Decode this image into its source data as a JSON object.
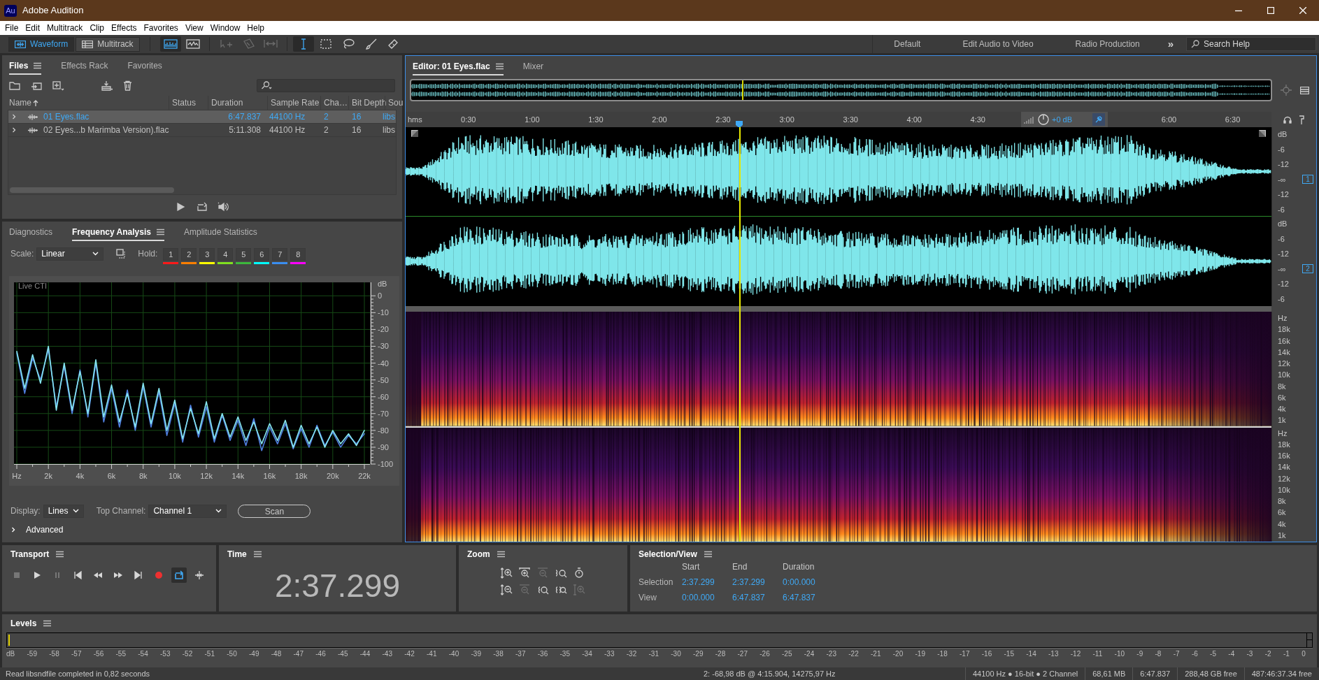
{
  "window": {
    "title": "Adobe Audition",
    "app_badge": "Au"
  },
  "menu": [
    "File",
    "Edit",
    "Multitrack",
    "Clip",
    "Effects",
    "Favorites",
    "View",
    "Window",
    "Help"
  ],
  "view_modes": [
    {
      "label": "Waveform",
      "kind": "waveform",
      "selected": true
    },
    {
      "label": "Multitrack",
      "kind": "multitrack",
      "selected": false
    }
  ],
  "tools": [
    {
      "kind": "spectral",
      "selected": true,
      "disabled": false
    },
    {
      "kind": "pitch",
      "selected": false,
      "disabled": false
    },
    {
      "kind": "move",
      "selected": false,
      "disabled": true
    },
    {
      "kind": "razor",
      "selected": false,
      "disabled": true
    },
    {
      "kind": "slip",
      "selected": false,
      "disabled": true
    },
    {
      "kind": "time",
      "selected": true,
      "disabled": false
    },
    {
      "kind": "marquee",
      "selected": false,
      "disabled": false
    },
    {
      "kind": "lasso",
      "selected": false,
      "disabled": false
    },
    {
      "kind": "brush",
      "selected": false,
      "disabled": false
    },
    {
      "kind": "heal",
      "selected": false,
      "disabled": false
    }
  ],
  "workspaces": [
    "Default",
    "Edit Audio to Video",
    "Radio Production"
  ],
  "workspace_more": "»",
  "help_search": {
    "placeholder": "Search Help"
  },
  "files": {
    "tabs": [
      {
        "label": "Files",
        "selected": true
      },
      {
        "label": "Effects Rack",
        "selected": false
      },
      {
        "label": "Favorites",
        "selected": false
      }
    ],
    "columns": [
      {
        "label": "Name",
        "sorted": true
      },
      {
        "label": "Status",
        "sorted": false
      },
      {
        "label": "Duration",
        "sorted": false
      },
      {
        "label": "Sample Rate",
        "sorted": false
      },
      {
        "label": "Cha…",
        "sorted": false
      },
      {
        "label": "Bit Depth",
        "sorted": false
      },
      {
        "label": "Sou",
        "sorted": false
      }
    ],
    "rows": [
      {
        "name": "01 Eyes.flac",
        "duration": "6:47.837",
        "sample_rate": "44100 Hz",
        "channels": "2",
        "bit_depth": "16",
        "source": "libs",
        "selected": true,
        "expanded": false
      },
      {
        "name": "02 Eyes...b Marimba Version).flac",
        "duration": "5:11.308",
        "sample_rate": "44100 Hz",
        "channels": "2",
        "bit_depth": "16",
        "source": "libs",
        "selected": false,
        "expanded": false
      }
    ]
  },
  "analysis": {
    "tabs": [
      {
        "label": "Diagnostics",
        "selected": false
      },
      {
        "label": "Frequency Analysis",
        "selected": true
      },
      {
        "label": "Amplitude Statistics",
        "selected": false
      }
    ],
    "scale": {
      "label": "Scale:",
      "value": "Linear"
    },
    "hold_label": "Hold:",
    "hold": [
      {
        "label": "1",
        "color": "#ff1a1a"
      },
      {
        "label": "2",
        "color": "#ff7f00"
      },
      {
        "label": "3",
        "color": "#ffff00"
      },
      {
        "label": "4",
        "color": "#80e020"
      },
      {
        "label": "5",
        "color": "#3cb83c"
      },
      {
        "label": "6",
        "color": "#00ffff"
      },
      {
        "label": "7",
        "color": "#3a8ef0"
      },
      {
        "label": "8",
        "color": "#ff00ff"
      }
    ],
    "live_label": "Live CTI",
    "chart_data": {
      "type": "line",
      "ylabel": "dB",
      "x": [
        0,
        500,
        1000,
        1500,
        2000,
        2500,
        3000,
        3500,
        4000,
        4500,
        5000,
        5500,
        6000,
        6500,
        7000,
        7500,
        8000,
        8500,
        9000,
        9500,
        10000,
        10500,
        11000,
        11500,
        12000,
        12500,
        13000,
        13500,
        14000,
        14500,
        15000,
        15500,
        16000,
        16500,
        17000,
        17500,
        18000,
        18500,
        19000,
        19500,
        20000,
        20500,
        21000,
        21500,
        22000
      ],
      "series": [
        {
          "color": "#4f7fe0",
          "values": [
            -34,
            -58,
            -37,
            -50,
            -32,
            -66,
            -42,
            -70,
            -44,
            -72,
            -40,
            -75,
            -55,
            -78,
            -56,
            -80,
            -54,
            -78,
            -57,
            -83,
            -64,
            -87,
            -65,
            -84,
            -66,
            -87,
            -71,
            -86,
            -74,
            -89,
            -73,
            -92,
            -78,
            -88,
            -76,
            -91,
            -79,
            -90,
            -77,
            -89,
            -81,
            -90,
            -83,
            -88,
            -82
          ]
        },
        {
          "color": "#86e6f0",
          "values": [
            -33,
            -55,
            -35,
            -52,
            -30,
            -68,
            -40,
            -68,
            -45,
            -70,
            -38,
            -72,
            -53,
            -75,
            -58,
            -78,
            -52,
            -76,
            -55,
            -80,
            -62,
            -85,
            -67,
            -82,
            -63,
            -85,
            -70,
            -84,
            -72,
            -86,
            -75,
            -88,
            -76,
            -86,
            -74,
            -90,
            -77,
            -88,
            -78,
            -90,
            -80,
            -88,
            -82,
            -89,
            -80
          ]
        }
      ],
      "xlim": [
        0,
        22000
      ],
      "ylim": [
        -100,
        8
      ],
      "xticks": [
        {
          "value": 0,
          "label": "Hz"
        },
        {
          "value": 2000,
          "label": "2k"
        },
        {
          "value": 4000,
          "label": "4k"
        },
        {
          "value": 6000,
          "label": "6k"
        },
        {
          "value": 8000,
          "label": "8k"
        },
        {
          "value": 10000,
          "label": "10k"
        },
        {
          "value": 12000,
          "label": "12k"
        },
        {
          "value": 14000,
          "label": "14k"
        },
        {
          "value": 16000,
          "label": "16k"
        },
        {
          "value": 18000,
          "label": "18k"
        },
        {
          "value": 20000,
          "label": "20k"
        },
        {
          "value": 22000,
          "label": "22k"
        }
      ],
      "yticks": [
        0,
        -10,
        -20,
        -30,
        -40,
        -50,
        -60,
        -70,
        -80,
        -90,
        -100
      ],
      "grid": true
    },
    "display": {
      "label": "Display:",
      "value": "Lines"
    },
    "top_channel": {
      "label": "Top Channel:",
      "value": "Channel 1"
    },
    "scan_button": "Scan",
    "advanced": {
      "label": "Advanced",
      "expanded": false
    }
  },
  "editor": {
    "tabs": [
      {
        "label": "Editor: 01 Eyes.flac",
        "selected": true
      },
      {
        "label": "Mixer",
        "selected": false
      }
    ],
    "ruler": [
      "hms",
      "0:30",
      "1:00",
      "1:30",
      "2:00",
      "2:30",
      "3:00",
      "3:30",
      "4:00",
      "4:30",
      "6:00",
      "6:30"
    ],
    "volume": "+0 dB",
    "channels": [
      {
        "badge": "1",
        "db_labels": [
          "dB",
          "-6",
          "-12",
          "-∞",
          "-12",
          "-6"
        ]
      },
      {
        "badge": "2",
        "db_labels": [
          "dB",
          "-6",
          "-12",
          "-∞",
          "-12",
          "-6"
        ]
      }
    ],
    "spectral_scales": [
      [
        "Hz",
        "18k",
        "16k",
        "14k",
        "12k",
        "10k",
        "8k",
        "6k",
        "4k",
        "1k"
      ],
      [
        "Hz",
        "18k",
        "16k",
        "14k",
        "12k",
        "10k",
        "8k",
        "6k",
        "4k",
        "1k"
      ]
    ]
  },
  "transport": {
    "title": "Transport",
    "buttons": [
      {
        "kind": "stop",
        "disabled": true,
        "on": false
      },
      {
        "kind": "play",
        "disabled": false,
        "on": false
      },
      {
        "kind": "pause",
        "disabled": true,
        "on": false
      },
      {
        "kind": "start",
        "disabled": false,
        "on": false
      },
      {
        "kind": "rewind",
        "disabled": false,
        "on": false
      },
      {
        "kind": "forward",
        "disabled": false,
        "on": false
      },
      {
        "kind": "end",
        "disabled": false,
        "on": false
      },
      {
        "kind": "record",
        "disabled": false,
        "on": false
      },
      {
        "kind": "loop",
        "disabled": false,
        "on": true
      },
      {
        "kind": "skip",
        "disabled": false,
        "on": false
      }
    ]
  },
  "time": {
    "title": "Time",
    "value": "2:37.299"
  },
  "zoom": {
    "title": "Zoom",
    "buttons": [
      {
        "kind": "amp-in",
        "disabled": false
      },
      {
        "kind": "time-in",
        "disabled": false
      },
      {
        "kind": "selection",
        "disabled": true
      },
      {
        "kind": "out-point",
        "disabled": false
      },
      {
        "kind": "full",
        "disabled": false
      },
      {
        "kind": "amp-out",
        "disabled": false
      },
      {
        "kind": "time-out",
        "disabled": true
      },
      {
        "kind": "in-point",
        "disabled": false
      },
      {
        "kind": "both",
        "disabled": false
      },
      {
        "kind": "amp-sel",
        "disabled": true
      }
    ]
  },
  "selection": {
    "title": "Selection/View",
    "columns": [
      "Start",
      "End",
      "Duration"
    ],
    "rows": [
      {
        "label": "Selection",
        "values": [
          "2:37.299",
          "2:37.299",
          "0:00.000"
        ]
      },
      {
        "label": "View",
        "values": [
          "0:00.000",
          "6:47.837",
          "6:47.837"
        ]
      }
    ]
  },
  "levels": {
    "title": "Levels",
    "scale": [
      "dB",
      "-59",
      "-58",
      "-57",
      "-56",
      "-55",
      "-54",
      "-53",
      "-52",
      "-51",
      "-50",
      "-49",
      "-48",
      "-47",
      "-46",
      "-45",
      "-44",
      "-43",
      "-42",
      "-41",
      "-40",
      "-39",
      "-38",
      "-37",
      "-36",
      "-35",
      "-34",
      "-33",
      "-32",
      "-31",
      "-30",
      "-29",
      "-28",
      "-27",
      "-26",
      "-25",
      "-24",
      "-23",
      "-22",
      "-21",
      "-20",
      "-19",
      "-18",
      "-17",
      "-16",
      "-15",
      "-14",
      "-13",
      "-12",
      "-11",
      "-10",
      "-9",
      "-8",
      "-7",
      "-6",
      "-5",
      "-4",
      "-3",
      "-2",
      "-1",
      "0"
    ]
  },
  "status": {
    "message": "Read libsndfile completed in 0,82 seconds",
    "cursor": "2: -68,98 dB @ 4:15.904, 14275,97 Hz",
    "format": "44100 Hz ● 16-bit ● 2 Channel",
    "size": "68,61 MB",
    "duration": "6:47.837",
    "disk_free": "288,48 GB free",
    "time_free": "487:46:37.34 free"
  }
}
